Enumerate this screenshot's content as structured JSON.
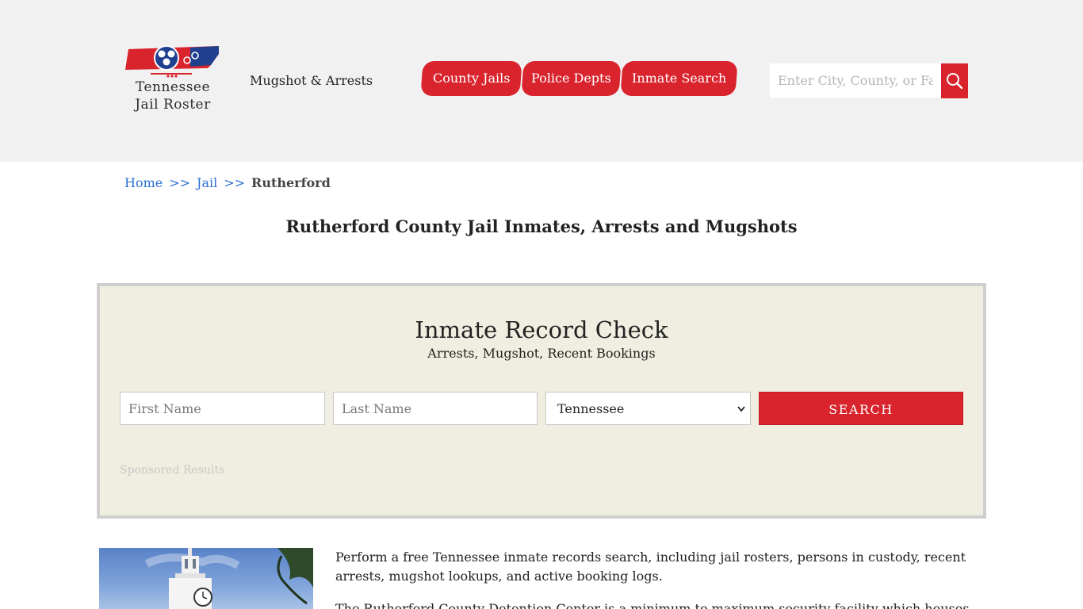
{
  "header": {
    "logo": {
      "line1": "Tennessee",
      "line2": "Jail Roster"
    },
    "tagline": "Mugshot & Arrests",
    "nav": [
      {
        "label": "County Jails"
      },
      {
        "label": "Police Depts"
      },
      {
        "label": "Inmate Search"
      }
    ],
    "search": {
      "placeholder": "Enter City, County, or Facility"
    },
    "colors": {
      "accent": "#d9232d",
      "header_bg": "#f1f1f1",
      "logo_blue": "#1f3f8f"
    }
  },
  "breadcrumb": {
    "items": [
      {
        "label": "Home"
      },
      {
        "label": "Jail"
      }
    ],
    "separator": ">>",
    "current": "Rutherford"
  },
  "page_title": "Rutherford County Jail Inmates, Arrests and Mugshots",
  "record_check": {
    "title": "Inmate Record Check",
    "subtitle": "Arrests, Mugshot, Recent Bookings",
    "first_name_placeholder": "First Name",
    "last_name_placeholder": "Last Name",
    "state_selected": "Tennessee",
    "search_label": "SEARCH",
    "sponsored": "Sponsored Results",
    "colors": {
      "panel_bg": "#f0eee0",
      "border": "#cfcfcf"
    }
  },
  "content": {
    "paragraph1": "Perform a free Tennessee inmate records search, including jail rosters, persons in custody, recent arrests, mugshot lookups, and active booking logs.",
    "paragraph2": "The Rutherford County Detention Center is a minimum to maximum security facility which houses adult"
  }
}
